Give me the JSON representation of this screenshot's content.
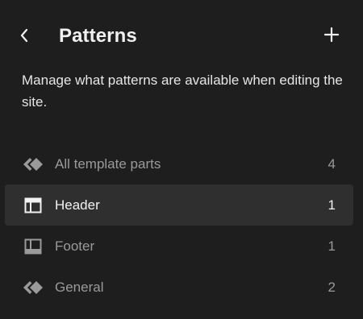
{
  "header": {
    "title": "Patterns",
    "back_icon": "chevron-left-icon",
    "add_icon": "plus-icon"
  },
  "description": "Manage what patterns are available when editing the site.",
  "nav": {
    "items": [
      {
        "label": "All template parts",
        "count": "4",
        "icon": "diamond-symbol-icon",
        "active": false
      },
      {
        "label": "Header",
        "count": "1",
        "icon": "layout-header-icon",
        "active": true
      },
      {
        "label": "Footer",
        "count": "1",
        "icon": "layout-footer-icon",
        "active": false
      },
      {
        "label": "General",
        "count": "2",
        "icon": "diamond-symbol-icon",
        "active": false
      }
    ]
  },
  "colors": {
    "background": "#1e1e1e",
    "active_row": "#2f2f2f",
    "text_primary": "#f0f0f0",
    "text_muted": "#9a9a9a"
  }
}
